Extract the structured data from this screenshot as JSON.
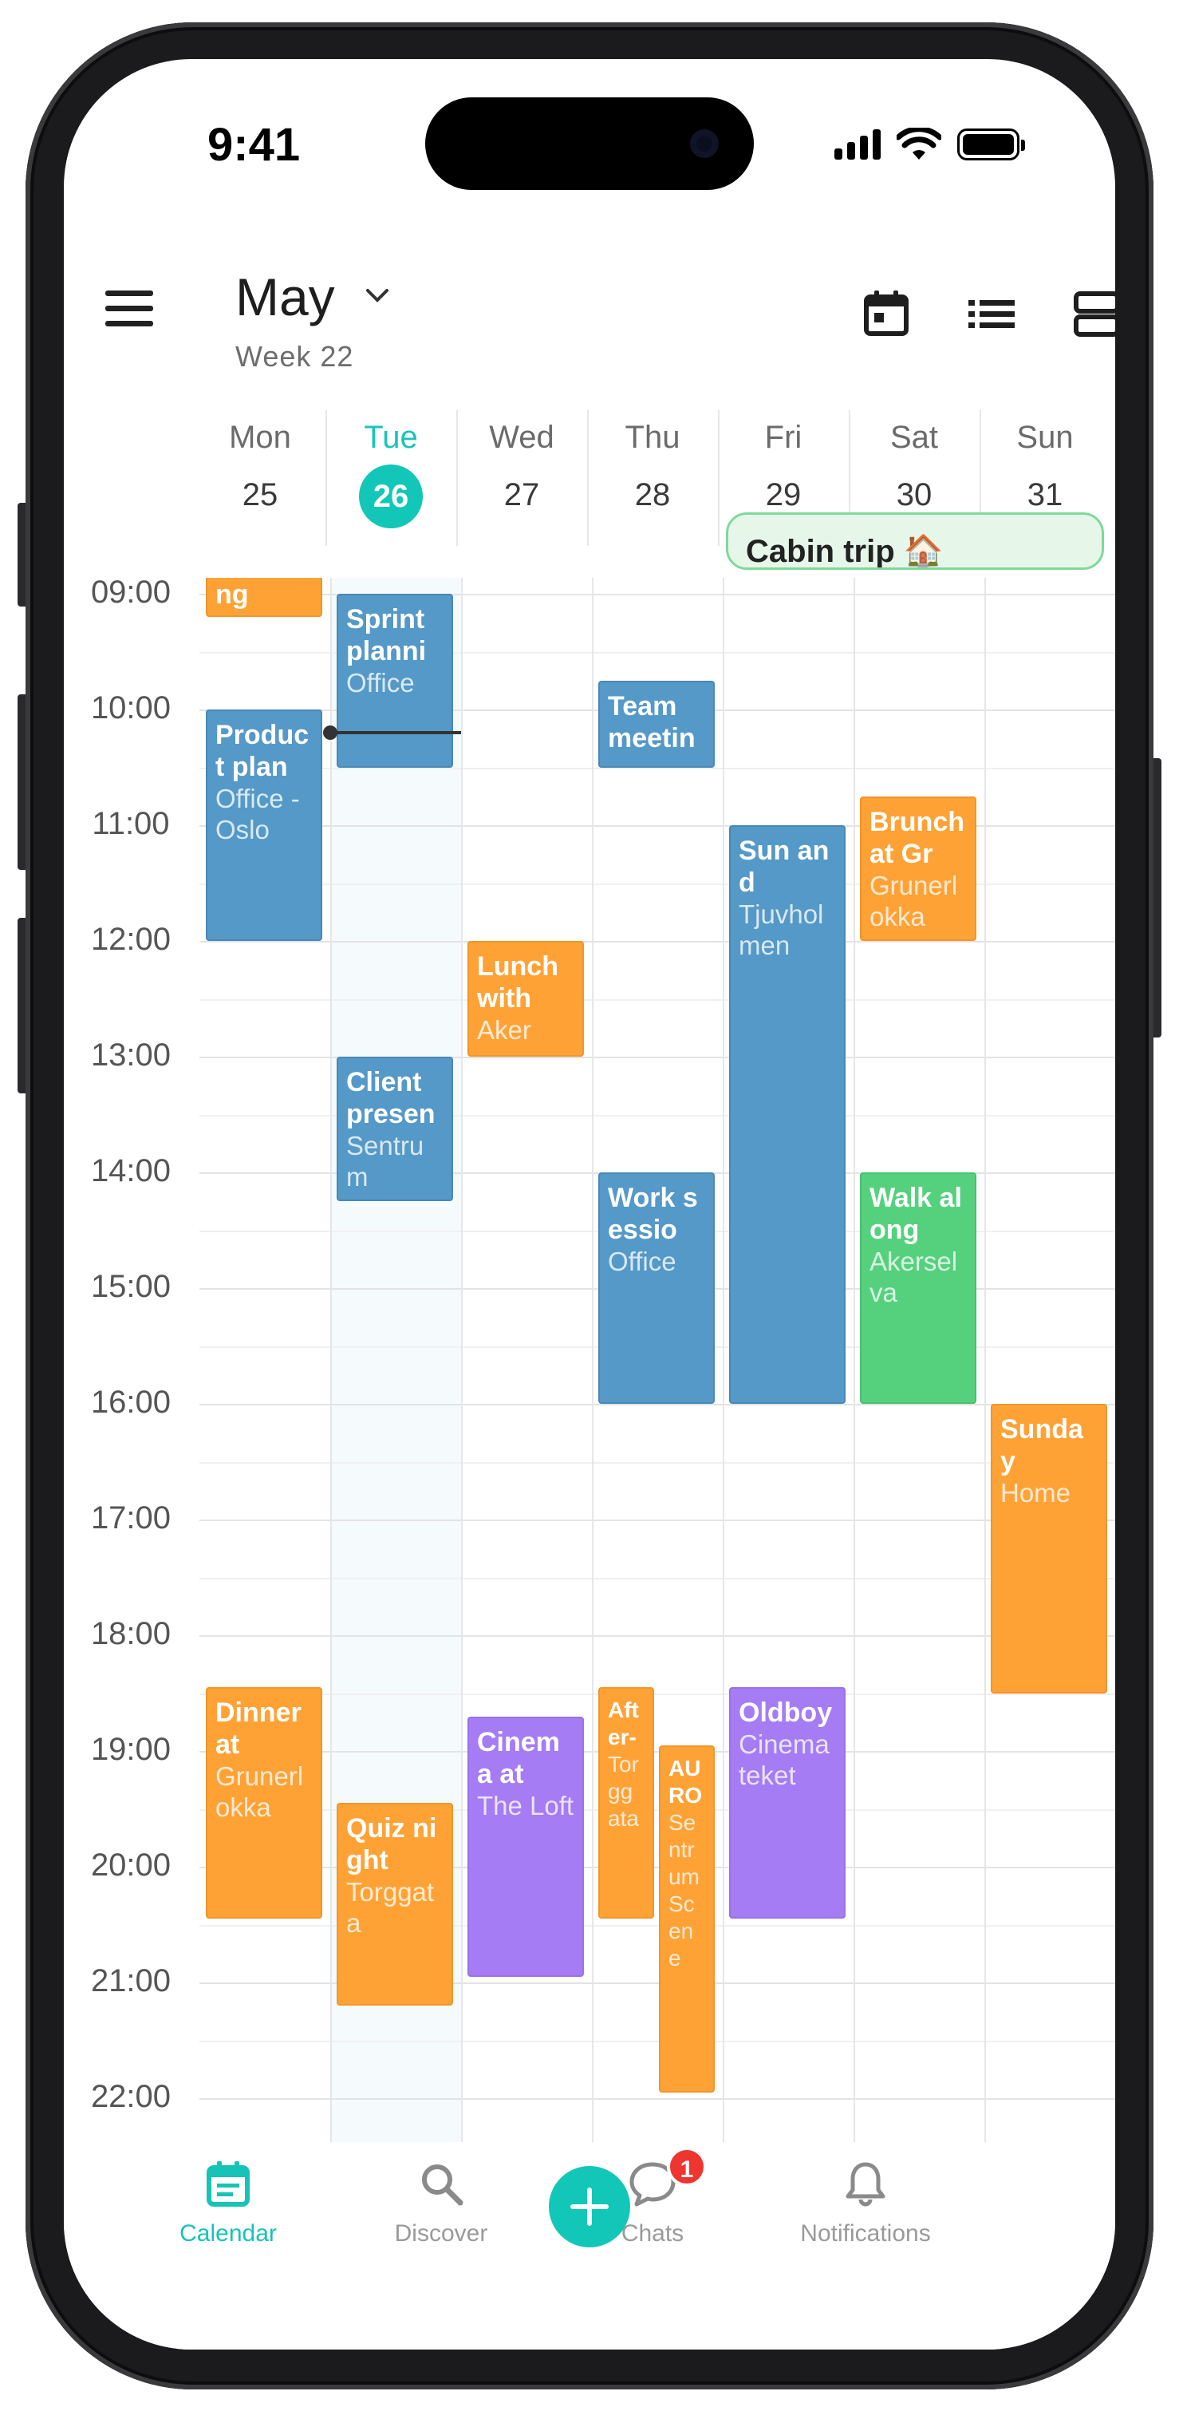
{
  "status_bar": {
    "time": "9:41"
  },
  "header": {
    "month": "May",
    "week": "Week 22"
  },
  "days": [
    {
      "name": "Mon",
      "num": "25"
    },
    {
      "name": "Tue",
      "num": "26",
      "today": true
    },
    {
      "name": "Wed",
      "num": "27"
    },
    {
      "name": "Thu",
      "num": "28"
    },
    {
      "name": "Fri",
      "num": "29"
    },
    {
      "name": "Sat",
      "num": "30"
    },
    {
      "name": "Sun",
      "num": "31"
    }
  ],
  "all_day_event": {
    "title": "Cabin trip 🏠",
    "color": "#e6f7ea"
  },
  "hours": [
    "09:00",
    "10:00",
    "11:00",
    "12:00",
    "13:00",
    "14:00",
    "15:00",
    "16:00",
    "17:00",
    "18:00",
    "19:00",
    "20:00",
    "21:00",
    "22:00"
  ],
  "current_time": "10:12",
  "events": [
    {
      "day": 0,
      "start": 8.5,
      "end": 9.2,
      "title": "ng",
      "subtitle": "",
      "color": "orange"
    },
    {
      "day": 0,
      "start": 10.0,
      "end": 12.0,
      "title": "Product plan",
      "subtitle": "Office - Oslo",
      "color": "blue"
    },
    {
      "day": 0,
      "start": 18.45,
      "end": 20.45,
      "title": "Dinner at",
      "subtitle": "Grunerlokka",
      "color": "orange"
    },
    {
      "day": 1,
      "start": 9.0,
      "end": 10.5,
      "title": "Sprint planni",
      "subtitle": "Office",
      "color": "blue"
    },
    {
      "day": 1,
      "start": 13.0,
      "end": 14.25,
      "title": "Client presen",
      "subtitle": "Sentrum",
      "color": "blue"
    },
    {
      "day": 1,
      "start": 19.45,
      "end": 21.2,
      "title": "Quiz night",
      "subtitle": "Torggata",
      "color": "orange"
    },
    {
      "day": 2,
      "start": 12.0,
      "end": 13.0,
      "title": "Lunch with",
      "subtitle": "Aker",
      "color": "orange"
    },
    {
      "day": 2,
      "start": 18.7,
      "end": 20.95,
      "title": "Cinema at",
      "subtitle": "The Loft",
      "color": "purple"
    },
    {
      "day": 3,
      "start": 9.75,
      "end": 10.5,
      "title": "Team meetin",
      "subtitle": "",
      "color": "blue"
    },
    {
      "day": 3,
      "start": 14.0,
      "end": 16.0,
      "title": "Work sessio",
      "subtitle": "Office",
      "color": "blue"
    },
    {
      "day": 3,
      "start": 18.45,
      "end": 20.45,
      "title": "After-",
      "subtitle": "Torggata",
      "color": "orange",
      "part": 0
    },
    {
      "day": 3,
      "start": 18.95,
      "end": 21.95,
      "title": "AURO",
      "subtitle": "Sentrum Scene",
      "color": "orange",
      "part": 1
    },
    {
      "day": 4,
      "start": 11.0,
      "end": 16.0,
      "title": "Sun and",
      "subtitle": "Tjuvholmen",
      "color": "blue"
    },
    {
      "day": 4,
      "start": 18.45,
      "end": 20.45,
      "title": "Oldboy",
      "subtitle": "Cinemateket",
      "color": "purple"
    },
    {
      "day": 5,
      "start": 10.75,
      "end": 12.0,
      "title": "Brunch at Gr",
      "subtitle": "Grunerlokka",
      "color": "orange"
    },
    {
      "day": 5,
      "start": 14.0,
      "end": 16.0,
      "title": "Walk along",
      "subtitle": "Akerselva",
      "color": "green"
    },
    {
      "day": 6,
      "start": 16.0,
      "end": 18.5,
      "title": "Sunday",
      "subtitle": "Home",
      "color": "orange"
    }
  ],
  "tabs": [
    {
      "label": "Calendar",
      "icon": "calendar-icon",
      "active": true
    },
    {
      "label": "Discover",
      "icon": "search-icon"
    },
    {
      "label": "",
      "icon": "plus-icon"
    },
    {
      "label": "Chats",
      "icon": "chat-icon",
      "badge": "1"
    },
    {
      "label": "Notifications",
      "icon": "bell-icon"
    }
  ],
  "colors": {
    "accent": "#12c7b7",
    "blue": "#5499c7",
    "orange": "#ffa236",
    "green": "#55d17e",
    "purple": "#a57cf3"
  }
}
